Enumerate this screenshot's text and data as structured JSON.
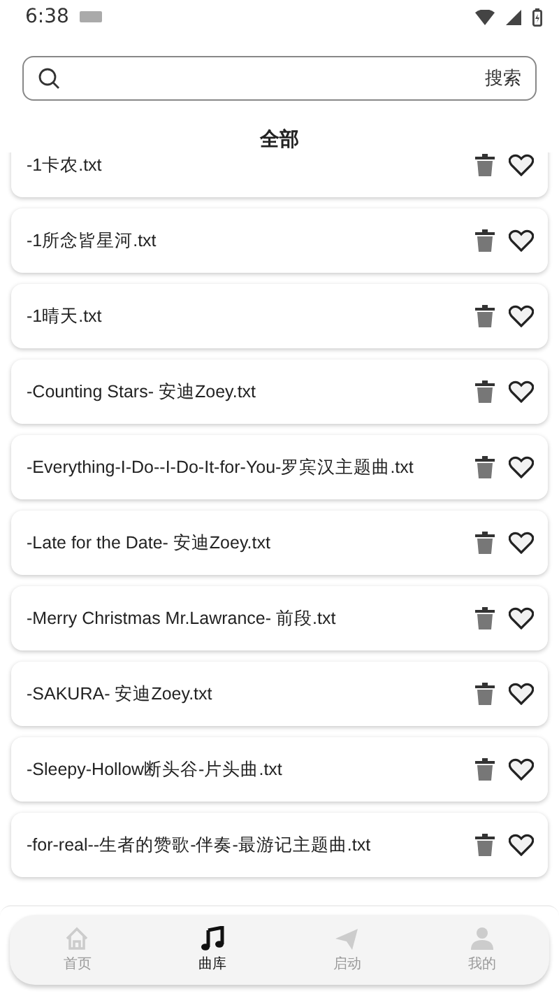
{
  "status_bar": {
    "time": "6:38"
  },
  "search": {
    "button": "搜索"
  },
  "section_title": "全部",
  "files": [
    {
      "name": "-1卡农.txt"
    },
    {
      "name": "-1所念皆星河.txt"
    },
    {
      "name": "-1晴天.txt"
    },
    {
      "name": "-Counting Stars- 安迪Zoey.txt"
    },
    {
      "name": "-Everything-I-Do--I-Do-It-for-You-罗宾汉主题曲.txt"
    },
    {
      "name": "-Late for the Date- 安迪Zoey.txt"
    },
    {
      "name": "-Merry Christmas Mr.Lawrance- 前段.txt"
    },
    {
      "name": "-SAKURA- 安迪Zoey.txt"
    },
    {
      "name": "-Sleepy-Hollow断头谷-片头曲.txt"
    },
    {
      "name": "-for-real--生者的赞歌-伴奏-最游记主题曲.txt"
    }
  ],
  "nav": [
    {
      "label": "首页",
      "kind": "home",
      "selected": false
    },
    {
      "label": "曲库",
      "kind": "music",
      "selected": true
    },
    {
      "label": "启动",
      "kind": "send",
      "selected": false
    },
    {
      "label": "我的",
      "kind": "person",
      "selected": false
    }
  ]
}
